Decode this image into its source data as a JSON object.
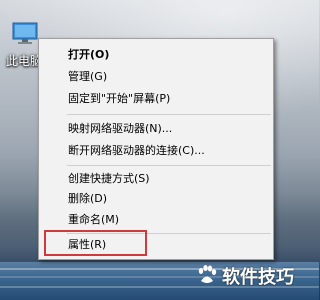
{
  "desktop": {
    "icon_label": "此电脑",
    "icon_name": "computer-icon"
  },
  "context_menu": {
    "items": [
      {
        "label": "打开(O)",
        "bold": true
      },
      {
        "label": "管理(G)"
      },
      {
        "label": "固定到\"开始\"屏幕(P)"
      },
      {
        "label": "映射网络驱动器(N)..."
      },
      {
        "label": "断开网络驱动器的连接(C)..."
      },
      {
        "label": "创建快捷方式(S)"
      },
      {
        "label": "删除(D)"
      },
      {
        "label": "重命名(M)"
      },
      {
        "label": "属性(R)",
        "highlighted": true
      }
    ]
  },
  "watermark": {
    "logo_name": "baidu-paw-logo",
    "text": "软件技巧"
  },
  "colors": {
    "menu_background": "#f2f2f2",
    "highlight_border": "#d03a3a",
    "separator": "#d0d0d0"
  }
}
